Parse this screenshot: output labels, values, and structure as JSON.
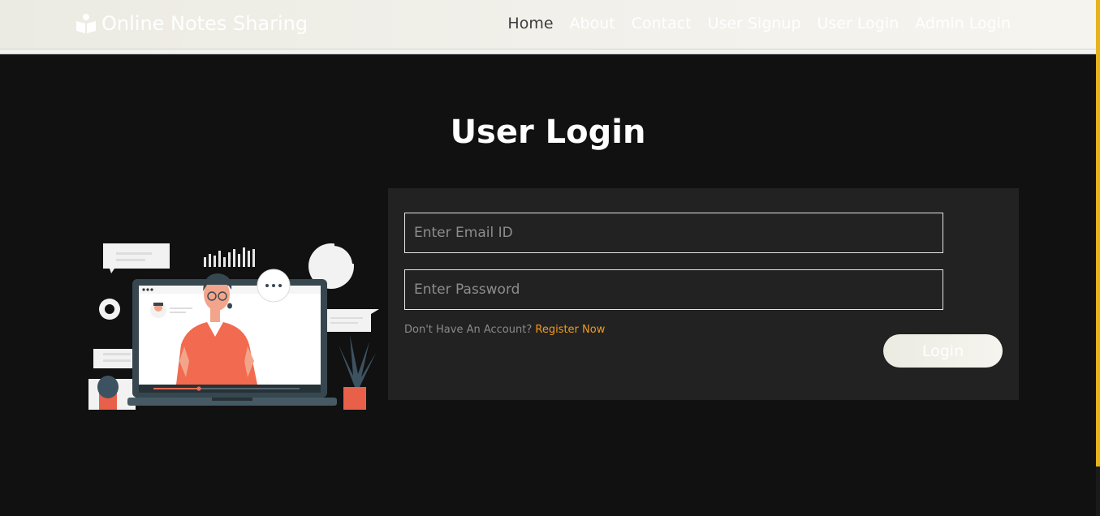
{
  "brand": {
    "name": "Online Notes Sharing",
    "icon": "book-reader-icon"
  },
  "nav": {
    "items": [
      {
        "label": "Home",
        "active": true
      },
      {
        "label": "About"
      },
      {
        "label": "Contact"
      },
      {
        "label": "User Signup"
      },
      {
        "label": "User Login"
      },
      {
        "label": "Admin Login"
      }
    ]
  },
  "page": {
    "title": "User Login"
  },
  "form": {
    "email_placeholder": "Enter Email ID",
    "password_placeholder": "Enter Password",
    "register_prompt": "Don't Have An Account?",
    "register_link": "Register Now",
    "submit_label": "Login"
  },
  "colors": {
    "accent": "#f39a1e",
    "background": "#111111",
    "panel": "#222222",
    "scroll_accent": "#e8b21c"
  }
}
